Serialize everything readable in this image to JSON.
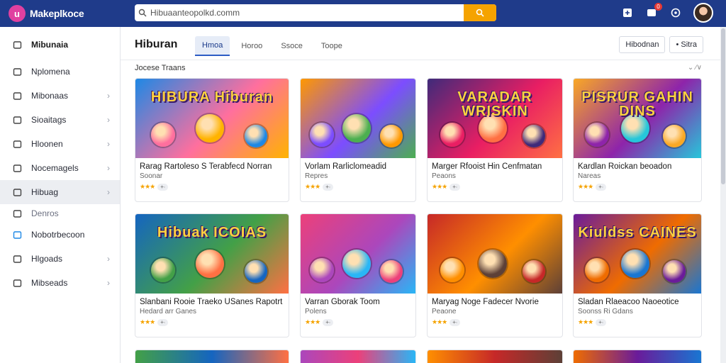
{
  "app": {
    "name": "Makeplkoce",
    "logo_letter": "u"
  },
  "search": {
    "value": "Hibuaanteopolkd.comm"
  },
  "topbar": {
    "notif_count": "0"
  },
  "sidebar": {
    "items": [
      {
        "label": "Mibunaia",
        "icon": "folder-icon"
      },
      {
        "label": "Nplomena",
        "icon": "grid-icon"
      },
      {
        "label": "Mibonaas",
        "icon": "chart-icon"
      },
      {
        "label": "Sioaitags",
        "icon": "tag-icon"
      },
      {
        "label": "Hloonen",
        "icon": "document-icon"
      },
      {
        "label": "Nocemagels",
        "icon": "image-icon"
      },
      {
        "label": "Hibuag",
        "icon": "film-icon"
      },
      {
        "label": "Denros",
        "icon": "ring-icon"
      },
      {
        "label": "Nobotrbecoon",
        "icon": "circle-icon"
      },
      {
        "label": "Hlgoads",
        "icon": "gear-icon"
      },
      {
        "label": "Mibseads",
        "icon": "location-icon"
      }
    ]
  },
  "main": {
    "title": "Hiburan",
    "tabs": [
      "Hmoa",
      "Horoo",
      "Ssoce",
      "Toope"
    ],
    "actions": [
      "Hibodnan",
      "• Sitra"
    ],
    "section_label": "Jocese Traans",
    "sort_label": "⌄ ∕∨"
  },
  "cards": [
    {
      "title": "Rarag Rartoleso S Terabfecd Norran",
      "sub": "Soonar",
      "banner": "HIBURA Hiburan",
      "colors": [
        "#1e88e5",
        "#ff6f9e",
        "#ffb300"
      ]
    },
    {
      "title": "Vorlam Rarliclomeadid",
      "sub": "Repres",
      "banner": "",
      "colors": [
        "#ff9800",
        "#7c4dff",
        "#4caf50"
      ]
    },
    {
      "title": "Marger Rfooist Hin Cenfmatan",
      "sub": "Peaons",
      "banner": "VARADAR WRISKIN",
      "colors": [
        "#3f2a7a",
        "#e91e63",
        "#ff7043"
      ]
    },
    {
      "title": "Kardlan Roickan beoadon",
      "sub": "Nareas",
      "banner": "PISRUR GAHIN DINS",
      "colors": [
        "#f9a825",
        "#8e24aa",
        "#26c6da"
      ]
    },
    {
      "title": "Slanbani Rooie Traeko USanes Rapotrt",
      "sub": "Hedard arr Ganes",
      "banner": "Hibuak ICOIAS",
      "colors": [
        "#1565c0",
        "#43a047",
        "#ff7043"
      ]
    },
    {
      "title": "Varran Gborak Toom",
      "sub": "Polens",
      "banner": "",
      "colors": [
        "#ec407a",
        "#ab47bc",
        "#29b6f6"
      ]
    },
    {
      "title": "Maryag Noge Fadecer Nvorie",
      "sub": "Peaone",
      "banner": "",
      "colors": [
        "#c62828",
        "#ff8f00",
        "#5d4037"
      ]
    },
    {
      "title": "Sladan Rlaeacoo Naoeotice",
      "sub": "Soonss Ri Gdans",
      "banner": "Kiuldss CAINES",
      "colors": [
        "#6a1b9a",
        "#ef6c00",
        "#1976d2"
      ]
    }
  ],
  "card_meta": {
    "pill": "+∙"
  },
  "colors": {
    "topbar": "#1f3b8a",
    "accent": "#f5a300",
    "brand": "#e040a0"
  }
}
